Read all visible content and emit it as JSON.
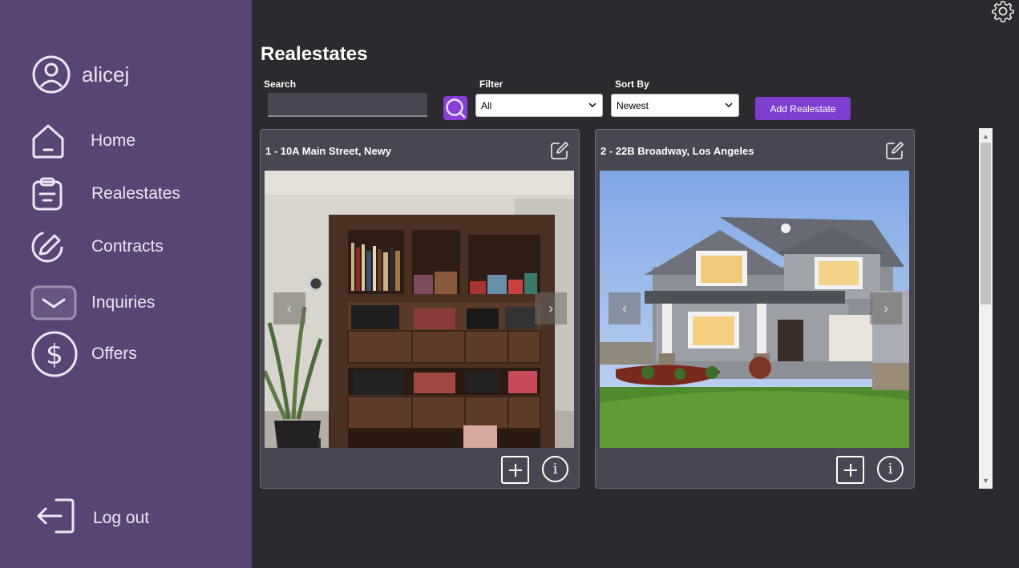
{
  "user": {
    "name": "alicej"
  },
  "nav": {
    "home": "Home",
    "realestates": "Realestates",
    "contracts": "Contracts",
    "inquiries": "Inquiries",
    "offers": "Offers",
    "logout": "Log out"
  },
  "page": {
    "title": "Realestates"
  },
  "filters": {
    "search_label": "Search",
    "search_value": "",
    "filter_label": "Filter",
    "filter_value": "All",
    "sort_label": "Sort By",
    "sort_value": "Newest",
    "add_button": "Add Realestate"
  },
  "listings": [
    {
      "title": "1 - 10A Main Street, Newy",
      "image": "bookshelf interior photo"
    },
    {
      "title": "2 - 22B Broadway, Los Angeles",
      "image": "house exterior photo"
    }
  ],
  "icons": {
    "settings": "gear-icon",
    "user": "user-icon",
    "home": "home-icon",
    "realestates": "clipboard-icon",
    "contracts": "pen-icon",
    "inquiries": "mail-icon",
    "offers": "dollar-icon",
    "logout": "logout-icon"
  },
  "colors": {
    "sidebar": "#5a4473",
    "background": "#2c292f",
    "card": "#4a4552",
    "accent": "#7e3fd0"
  }
}
